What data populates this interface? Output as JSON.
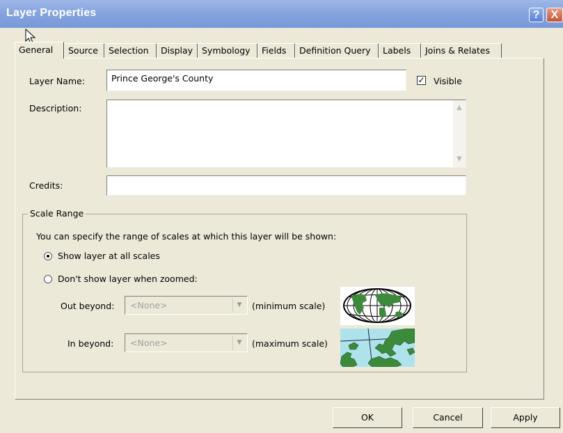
{
  "window": {
    "title": "Layer Properties"
  },
  "title_buttons": {
    "help": "?",
    "close": "X"
  },
  "tabs": [
    {
      "label": "General",
      "active": true
    },
    {
      "label": "Source"
    },
    {
      "label": "Selection"
    },
    {
      "label": "Display"
    },
    {
      "label": "Symbology"
    },
    {
      "label": "Fields"
    },
    {
      "label": "Definition Query"
    },
    {
      "label": "Labels"
    },
    {
      "label": "Joins & Relates"
    }
  ],
  "general": {
    "layer_name_label": "Layer Name:",
    "layer_name_value": "Prince George's County",
    "visible_label": "Visible",
    "visible_checked": true,
    "description_label": "Description:",
    "description_value": "",
    "credits_label": "Credits:",
    "credits_value": ""
  },
  "scale_range": {
    "title": "Scale Range",
    "intro": "You can specify the range of scales at which this layer will be shown:",
    "option_all": "Show layer at all scales",
    "option_zoomed": "Don't show layer when zoomed:",
    "selected": "all",
    "out_beyond_label": "Out beyond:",
    "out_beyond_value": "<None>",
    "out_beyond_hint": "(minimum scale)",
    "in_beyond_label": "In beyond:",
    "in_beyond_value": "<None>",
    "in_beyond_hint": "(maximum scale)",
    "icons": [
      "globe-map-icon",
      "zoomed-map-icon"
    ]
  },
  "buttons": {
    "ok": "OK",
    "cancel": "Cancel",
    "apply": "Apply"
  },
  "colors": {
    "titlebar": "#86a4de",
    "dialog_bg": "#ece9d8",
    "map_land": "#3c8a3c",
    "map_water": "#aee3ec"
  }
}
